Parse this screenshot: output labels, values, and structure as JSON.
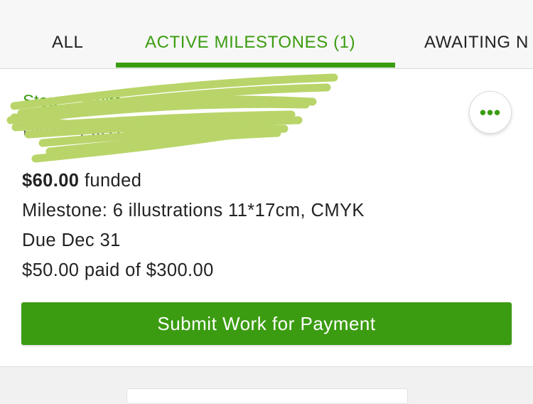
{
  "tabs": {
    "all": "ALL",
    "active": "ACTIVE MILESTONES (1)",
    "awaiting": "AWAITING N"
  },
  "contract": {
    "title": "Stop ... ...ults",
    "client": "Hired by ... Asia",
    "more_label": "•••",
    "funded_amount": "$60.00",
    "funded_label": " funded",
    "milestone": "Milestone: 6 illustrations 11*17cm, CMYK",
    "due": "Due Dec 31",
    "paid": "$50.00 paid of $300.00",
    "submit_label": "Submit Work for Payment"
  },
  "colors": {
    "brand_green": "#3b9c11",
    "redaction_green": "#b9d56a"
  },
  "icons": {
    "more": "more-horizontal-icon"
  }
}
